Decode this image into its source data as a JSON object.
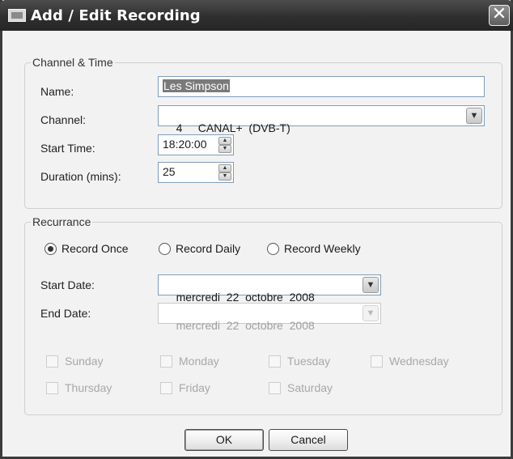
{
  "window": {
    "title": "Add / Edit Recording",
    "close_glyph": "✕"
  },
  "channel_time": {
    "legend": "Channel & Time",
    "name_label": "Name:",
    "name_value": "Les Simpson",
    "channel_label": "Channel:",
    "channel_value": "4     CANAL+  (DVB-T)",
    "start_time_label": "Start Time:",
    "start_time_value": "18:20:00",
    "duration_label": "Duration (mins):",
    "duration_value": "25"
  },
  "recurrence": {
    "legend": "Recurrance",
    "options": [
      {
        "label": "Record Once",
        "checked": true
      },
      {
        "label": "Record Daily",
        "checked": false
      },
      {
        "label": "Record Weekly",
        "checked": false
      }
    ],
    "start_date_label": "Start Date:",
    "start_date_value": "mercredi  22  octobre  2008",
    "end_date_label": "End Date:",
    "end_date_value": "mercredi  22  octobre  2008",
    "days": [
      "Sunday",
      "Monday",
      "Tuesday",
      "Wednesday",
      "Thursday",
      "Friday",
      "Saturday"
    ]
  },
  "buttons": {
    "ok": "OK",
    "cancel": "Cancel"
  },
  "icons": {
    "window": "tv-icon",
    "close": "close-icon",
    "dropdown": "chevron-down-icon",
    "spin_up": "triangle-up-icon",
    "spin_down": "triangle-down-icon"
  }
}
